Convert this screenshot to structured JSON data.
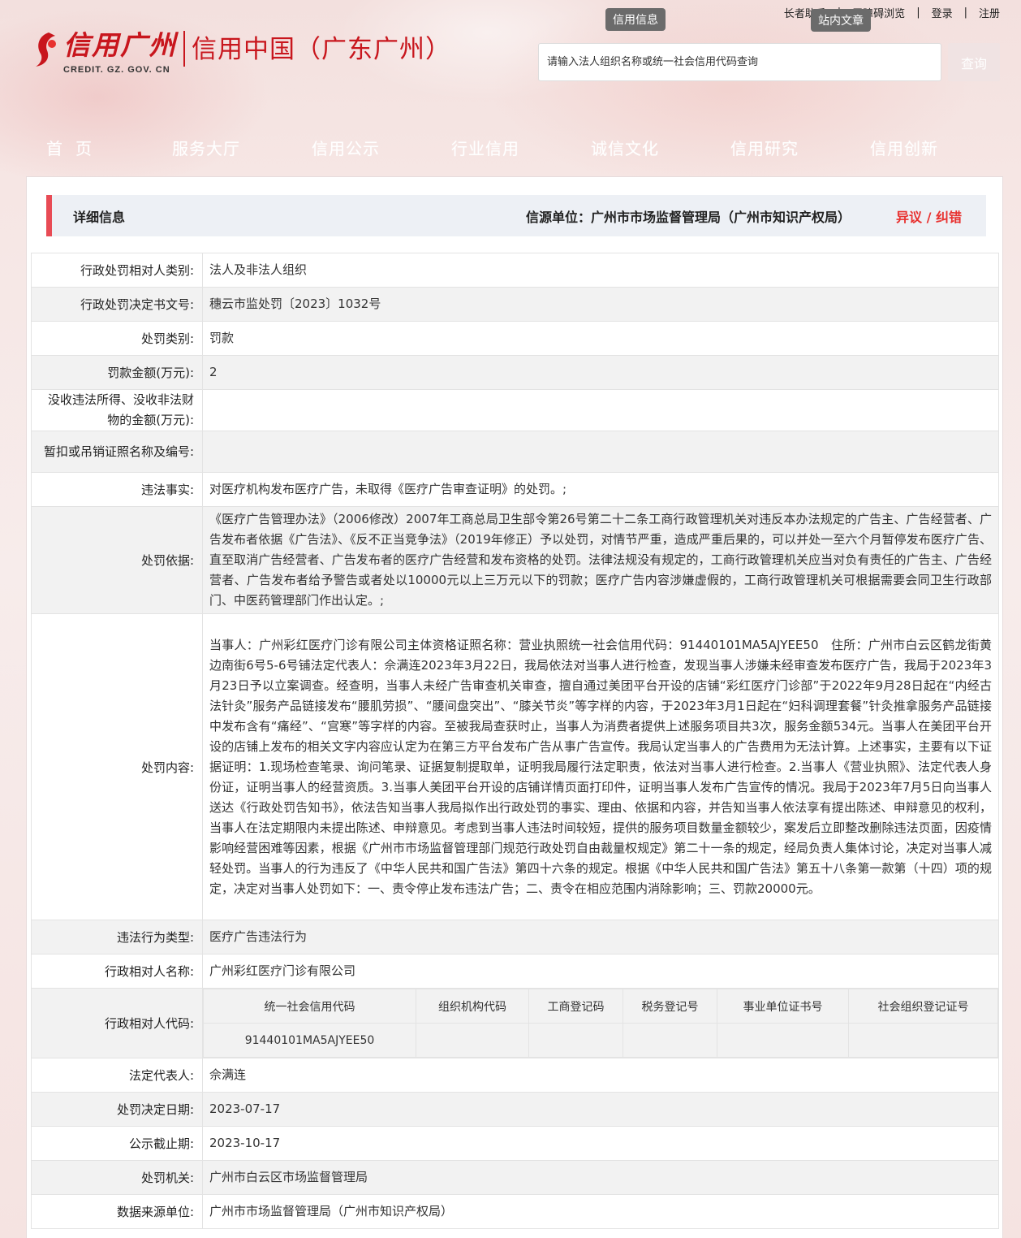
{
  "header": {
    "top_links": [
      "长者助手",
      "无障碍浏览",
      "登录",
      "注册"
    ],
    "tooltips": [
      "信用信息",
      "站内文章"
    ],
    "logo_cn": "信用广州",
    "logo_en": "CREDIT. GZ. GOV. CN",
    "logo_right": "信用中国（广东广州）",
    "search_placeholder": "请输入法人组织名称或统一社会信用代码查询",
    "search_button": "查询",
    "nav": [
      "首页",
      "服务大厅",
      "信用公示",
      "行业信用",
      "诚信文化",
      "信用研究",
      "信用创新"
    ]
  },
  "detail": {
    "title": "详细信息",
    "source": "信源单位：广州市市场监督管理局（广州市知识产权局）",
    "objection": "异议 / 纠错"
  },
  "fields": {
    "party_type": {
      "label": "行政处罚相对人类别:",
      "value": "法人及非法人组织"
    },
    "doc_no": {
      "label": "行政处罚决定书文号:",
      "value": "穗云市监处罚〔2023〕1032号"
    },
    "penalty_type": {
      "label": "处罚类别:",
      "value": "罚款"
    },
    "fine": {
      "label": "罚款金额(万元):",
      "value": "2"
    },
    "confiscation": {
      "label": "没收违法所得、没收非法财物的金额(万元):",
      "value": ""
    },
    "license": {
      "label": "暂扣或吊销证照名称及编号:",
      "value": ""
    },
    "facts": {
      "label": "违法事实:",
      "value": "对医疗机构发布医疗广告，未取得《医疗广告审查证明》的处罚。;"
    },
    "basis": {
      "label": "处罚依据:",
      "value": "《医疗广告管理办法》（2006修改）2007年工商总局卫生部令第26号第二十二条工商行政管理机关对违反本办法规定的广告主、广告经营者、广告发布者依据《广告法》、《反不正当竞争法》（2019年修正）予以处罚，对情节严重，造成严重后果的，可以并处一至六个月暂停发布医疗广告、直至取消广告经营者、广告发布者的医疗广告经营和发布资格的处罚。法律法规没有规定的，工商行政管理机关应当对负有责任的广告主、广告经营者、广告发布者给予警告或者处以10000元以上三万元以下的罚款；医疗广告内容涉嫌虚假的，工商行政管理机关可根据需要会同卫生行政部门、中医药管理部门作出认定。;"
    },
    "content": {
      "label": "处罚内容:",
      "value": "当事人：广州彩红医疗门诊有限公司主体资格证照名称：营业执照统一社会信用代码：91440101MA5AJYEE50　住所：广州市白云区鹤龙街黄边南街6号5-6号铺法定代表人：佘满连2023年3月22日，我局依法对当事人进行检查，发现当事人涉嫌未经审查发布医疗广告，我局于2023年3月23日予以立案调查。经查明，当事人未经广告审查机关审查，擅自通过美团平台开设的店铺“彩红医疗门诊部”于2022年9月28日起在“内经古法针灸”服务产品链接发布“腰肌劳损”、“腰间盘突出”、“膝关节炎”等字样的内容，于2023年3月1日起在“妇科调理套餐”针灸推拿服务产品链接中发布含有“痛经”、“宫寒”等字样的内容。至被我局查获时止，当事人为消费者提供上述服务项目共3次，服务金额534元。当事人在美团平台开设的店铺上发布的相关文字内容应认定为在第三方平台发布广告从事广告宣传。我局认定当事人的广告费用为无法计算。上述事实，主要有以下证据证明：1.现场检查笔录、询问笔录、证据复制提取单，证明我局履行法定职责，依法对当事人进行检查。2.当事人《营业执照》、法定代表人身份证，证明当事人的经营资质。3.当事人美团平台开设的店铺详情页面打印件，证明当事人发布广告宣传的情况。我局于2023年7月5日向当事人送达《行政处罚告知书》，依法告知当事人我局拟作出行政处罚的事实、理由、依据和内容，并告知当事人依法享有提出陈述、申辩意见的权利，当事人在法定期限内未提出陈述、申辩意见。考虑到当事人违法时间较短，提供的服务项目数量金额较少，案发后立即整改删除违法页面，因疫情影响经营困难等因素，根据《广州市市场监督管理部门规范行政处罚自由裁量权规定》第二十一条的规定，经局负责人集体讨论，决定对当事人减轻处罚。当事人的行为违反了《中华人民共和国广告法》第四十六条的规定。根据《中华人民共和国广告法》第五十八条第一款第（十四）项的规定，决定对当事人处罚如下：一、责令停止发布违法广告；二、责令在相应范围内消除影响；三、罚款20000元。"
    },
    "violation_type": {
      "label": "违法行为类型:",
      "value": "医疗广告违法行为"
    },
    "party_name": {
      "label": "行政相对人名称:",
      "value": "广州彩红医疗门诊有限公司"
    },
    "party_code": {
      "label": "行政相对人代码:"
    },
    "legal_rep": {
      "label": "法定代表人:",
      "value": "佘满连"
    },
    "decision_date": {
      "label": "处罚决定日期:",
      "value": "2023-07-17"
    },
    "deadline": {
      "label": "公示截止期:",
      "value": "2023-10-17"
    },
    "authority": {
      "label": "处罚机关:",
      "value": "广州市白云区市场监督管理局"
    },
    "data_source": {
      "label": "数据来源单位:",
      "value": "广州市市场监督管理局（广州市知识产权局）"
    }
  },
  "codes": {
    "headers": [
      "统一社会信用代码",
      "组织机构代码",
      "工商登记码",
      "税务登记号",
      "事业单位证书号",
      "社会组织登记证号"
    ],
    "values": [
      "91440101MA5AJYEE50",
      "",
      "",
      "",
      "",
      ""
    ]
  },
  "colors": {
    "brand_red": "#c8161d",
    "accent_bar": "#e84b55",
    "objection": "#e8312f"
  }
}
